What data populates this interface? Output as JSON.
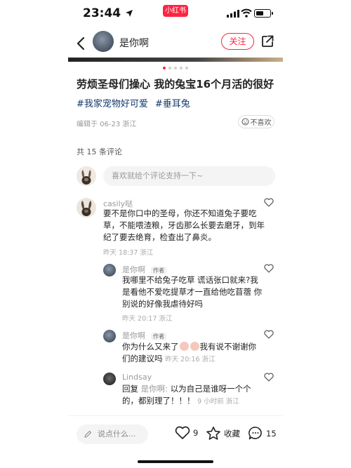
{
  "status_bar": {
    "time": "23:44",
    "app_badge": "小红书",
    "battery_level": 0.6
  },
  "header": {
    "author_name": "是你啊",
    "follow_label": "关注",
    "icons": [
      "back-icon",
      "share-icon"
    ]
  },
  "carousel": {
    "total": 5,
    "active_index": 0
  },
  "post": {
    "title": "劳烦圣母们操心 我的兔宝16个月活的很好",
    "tags": [
      "#我家宠物好可爱",
      "#垂耳兔"
    ],
    "meta": "编辑于 06-23 浙江",
    "dislike_label": "不喜欢"
  },
  "comments_section": {
    "count_text": "共 15 条评论",
    "input_placeholder": "喜欢就给个评论支持一下~",
    "comments": [
      {
        "author": "casily哒",
        "text": "要不是你口中的圣母，你还不知道兔子要吃草，不能喂渣粮，牙齿那么长要去磨牙，到年纪了要去绝育，检查出了鼻炎。",
        "time": "昨天 18:37 浙江",
        "replies": [
          {
            "author": "是你啊",
            "author_tag": "作者",
            "text": "我哪里不给兔子吃草 谎话张口就来?我是看他不爱吃提草才一直给他吃苜蓿 你别说的好像我虐待好吗",
            "time": "昨天 20:17 浙江"
          },
          {
            "author": "是你啊",
            "author_tag": "作者",
            "text_before": "你为什么又来了",
            "text_after": "我有说不谢谢你们的建议吗",
            "time": "昨天 20:16 浙江"
          },
          {
            "author": "Lindsay",
            "reply_prefix": "回复",
            "reply_to": "是你啊:",
            "text": "以为自己是谁呀一个个的，都别理了！！！",
            "time": "9 小时前 浙江"
          }
        ]
      }
    ]
  },
  "bottom_bar": {
    "input_placeholder": "说点什么...",
    "likes": "9",
    "collect_label": "收藏",
    "comments": "15"
  }
}
